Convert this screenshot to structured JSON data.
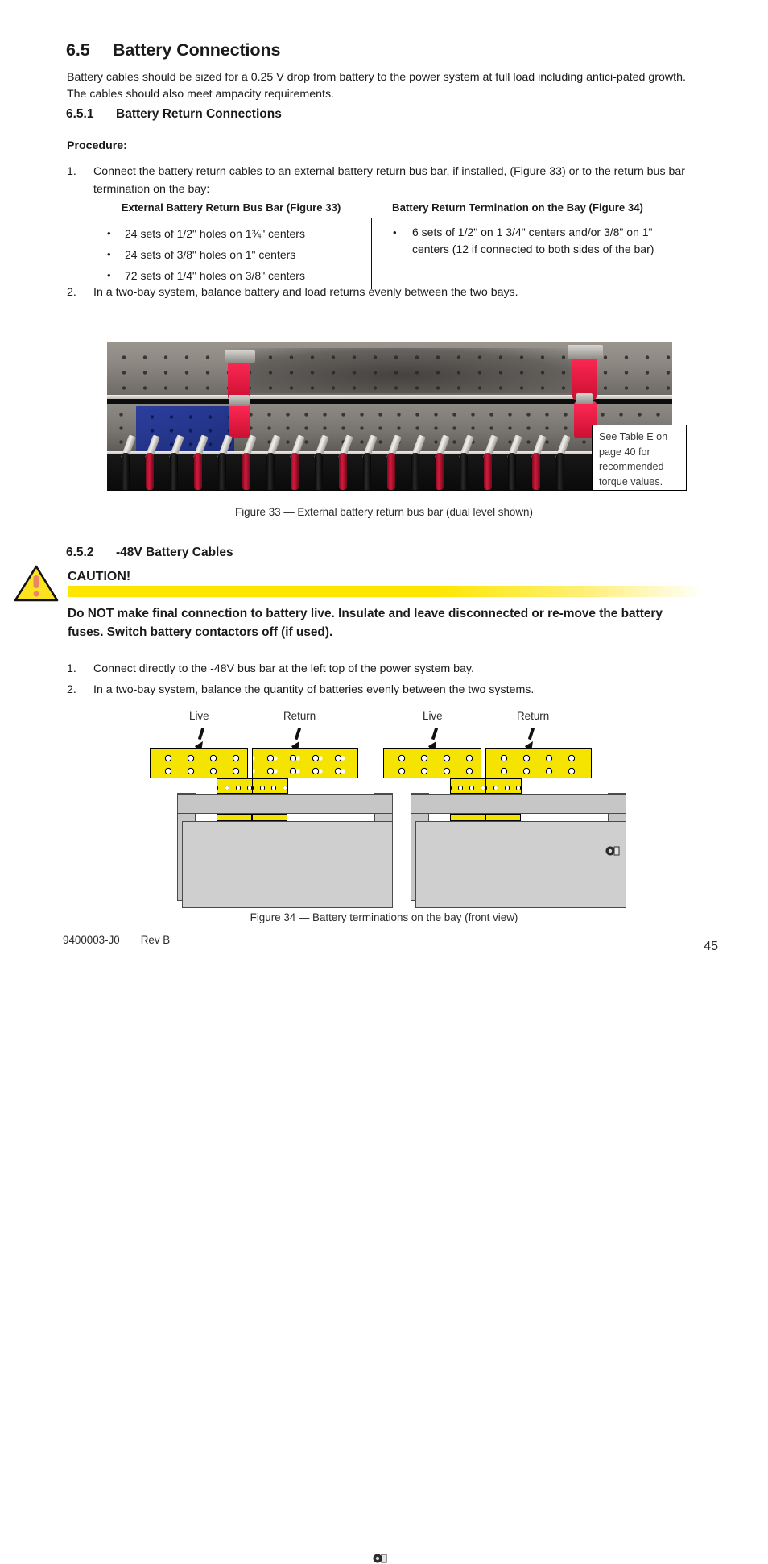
{
  "section": {
    "number": "6.5",
    "title": "Battery Connections",
    "intro": "Battery cables should be sized for a 0.25 V drop from battery to the power system at full load including antici-pated growth. The cables should also meet ampacity requirements."
  },
  "subsection_1": {
    "number": "6.5.1",
    "title": "Battery Return Connections",
    "procedure_label": "Procedure:",
    "step1_num": "1.",
    "step1_text": "Connect the battery return cables to an external battery return bus bar, if installed, (Figure 33) or to the return bus bar termination on the bay:",
    "step2_num": "2.",
    "step2_text": "In a two-bay system, balance battery and load returns evenly between the two bays."
  },
  "table": {
    "headers": [
      "External Battery Return Bus Bar (Figure 33)",
      "Battery Return Termination on the Bay (Figure 34)"
    ],
    "col1_bullets": [
      "24 sets of 1/2\" holes on 1¾\" centers",
      "24 sets of 3/8\" holes on 1\" centers",
      "72 sets of 1/4\" holes on 3/8\" centers"
    ],
    "col2_bullets": [
      "6 sets of 1/2\" on 1 3/4\" centers and/or 3/8\" on 1\" centers (12 if connected to both sides of the bar)"
    ]
  },
  "figure33": {
    "callout": "See Table E on page 40  for recommended torque values.",
    "caption": "Figure 33  —  External battery return bus bar (dual level shown)"
  },
  "subsection_2": {
    "number": "6.5.2",
    "title": "-48V Battery Cables",
    "caution_word": "CAUTION!",
    "caution_text": "Do NOT make final connection to battery live. Insulate and leave disconnected or re-move the battery fuses. Switch battery contactors off (if used).",
    "step1_num": "1.",
    "step1_text": "Connect directly to the -48V bus bar at the left top of the power system bay.",
    "step2_num": "2.",
    "step2_text": "In a two-bay system, balance the quantity of batteries evenly between the two systems."
  },
  "figure34": {
    "labels": {
      "live_left": "Live",
      "return_left": "Return",
      "live_right": "Live",
      "return_right": "Return"
    },
    "caption": "Figure 34  —  Battery terminations on the bay (front view)"
  },
  "footer": {
    "doc_number": "9400003-J0",
    "revision": "Rev B",
    "page_number": "45"
  },
  "colors": {
    "caution_yellow": "#ffe600",
    "busbar_yellow": "#f5e400",
    "cabinet_gray": "#cfcfcf",
    "warning_icon_mark": "#e8856b"
  }
}
